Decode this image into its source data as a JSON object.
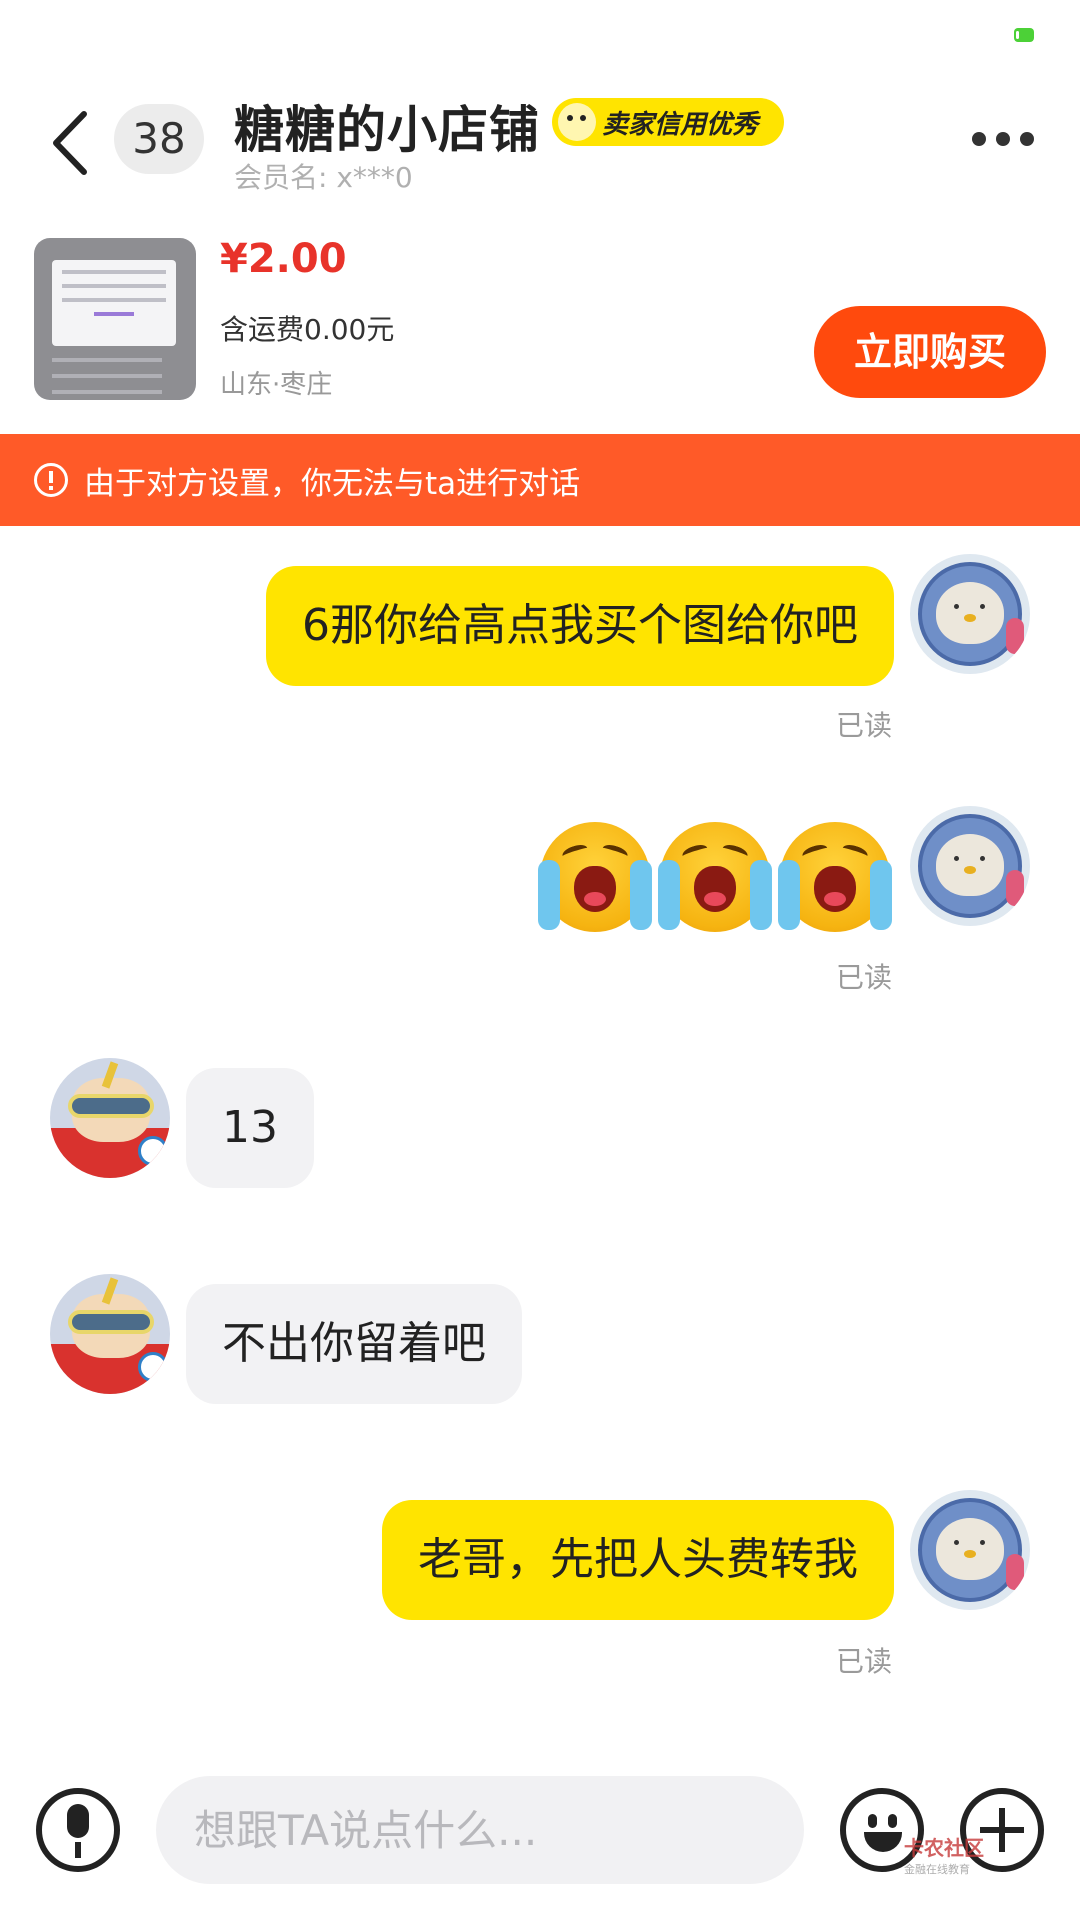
{
  "header": {
    "unread_count": "38",
    "shop_name": "糖糖的小店铺",
    "credit_badge": "卖家信用优秀",
    "member_label": "会员名: x***0"
  },
  "product": {
    "price": "¥2.00",
    "shipping": "含运费0.00元",
    "location": "山东·枣庄",
    "buy_label": "立即购买"
  },
  "notice": {
    "text": "由于对方设置，你无法与ta进行对话"
  },
  "messages": [
    {
      "sender": "me",
      "type": "text",
      "text": "6那你给高点我买个图给你吧",
      "status": "已读"
    },
    {
      "sender": "me",
      "type": "emoji",
      "emoji": [
        "crying-emoji",
        "crying-emoji",
        "crying-emoji"
      ],
      "status": "已读"
    },
    {
      "sender": "other",
      "type": "text",
      "text": "13"
    },
    {
      "sender": "other",
      "type": "text",
      "text": "不出你留着吧"
    },
    {
      "sender": "me",
      "type": "text",
      "text": "老哥，先把人头费转我",
      "status": "已读"
    }
  ],
  "input": {
    "placeholder": "想跟TA说点什么..."
  },
  "watermark": {
    "title": "卡农社区",
    "subtitle": "金融在线教育"
  },
  "colors": {
    "accent_yellow": "#ffe400",
    "buy_orange": "#ff4a0d",
    "notice_orange": "#ff5a28",
    "price_red": "#e8332a"
  }
}
